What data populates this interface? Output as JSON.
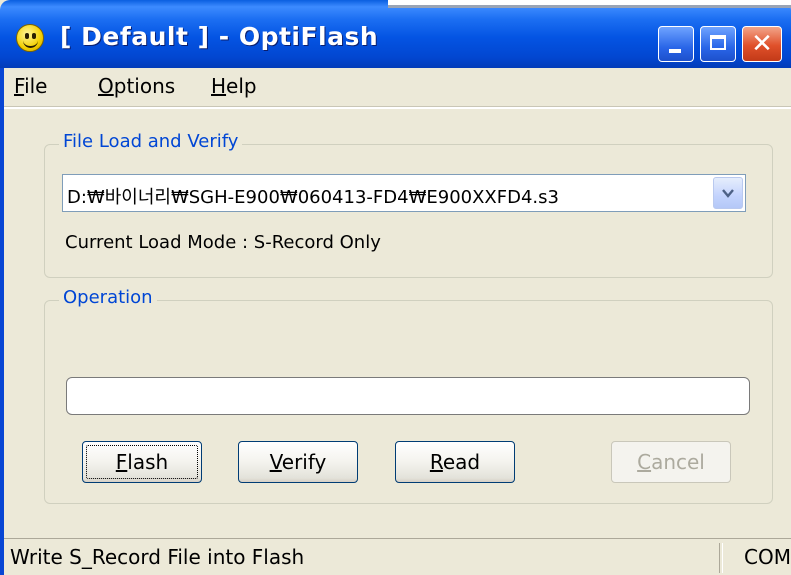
{
  "window": {
    "title": "[ Default ] - OptiFlash",
    "icon": "smiley-icon"
  },
  "menu": {
    "file": {
      "prefix": "F",
      "rest": "ile"
    },
    "options": {
      "prefix": "O",
      "rest": "ptions"
    },
    "help": {
      "prefix": "H",
      "rest": "elp"
    }
  },
  "file_group": {
    "label": "File Load and Verify",
    "path": "D:₩바이너리₩SGH-E900₩060413-FD4₩E900XXFD4.s3",
    "load_mode": "Current Load Mode : S-Record Only"
  },
  "operation_group": {
    "label": "Operation",
    "progress": 0
  },
  "buttons": {
    "flash": {
      "prefix": "F",
      "rest": "lash"
    },
    "verify": {
      "prefix": "V",
      "rest": "erify"
    },
    "read": {
      "prefix": "R",
      "rest": "ead"
    },
    "cancel": {
      "prefix": "C",
      "rest": "ancel"
    }
  },
  "status": {
    "text": "Write S_Record File into Flash",
    "port": "COM"
  },
  "colors": {
    "titlebar": "#0454e3",
    "group_label": "#0046d5",
    "face": "#ece9d8"
  }
}
